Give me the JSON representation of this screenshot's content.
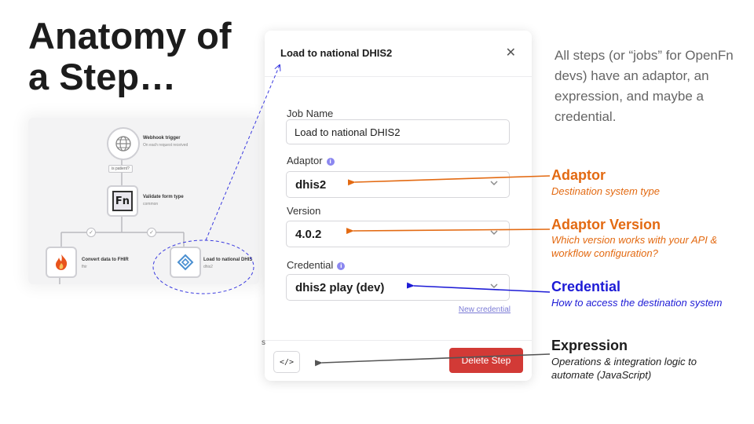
{
  "slide": {
    "title_line1": "Anatomy of",
    "title_line2": "a Step…",
    "intro": "All steps (or “jobs” for OpenFn devs) have an adaptor, an expression, and maybe a credential."
  },
  "workflow": {
    "trigger": {
      "label": "Webhook trigger",
      "sub": "On each request received",
      "icon": "globe-icon"
    },
    "edge_label": "is patient?",
    "validate": {
      "label": "Validate form type",
      "sub": "common",
      "icon_text": "Fn"
    },
    "convert": {
      "label": "Convert data to FHIR",
      "sub": "fhir",
      "icon": "flame-icon"
    },
    "load": {
      "label": "Load to national DHIS",
      "sub": "dhis2",
      "icon": "layers-icon"
    }
  },
  "modal": {
    "title": "Load to national DHIS2",
    "close_icon": "close-icon",
    "job_name_label": "Job Name",
    "job_name_value": "Load to national DHIS2",
    "adaptor_label": "Adaptor",
    "adaptor_value": "dhis2",
    "version_label": "Version",
    "version_value": "4.0.2",
    "credential_label": "Credential",
    "credential_value": "dhis2 play (dev)",
    "new_credential": "New credential",
    "code_button": "</>",
    "delete_button": "Delete Step",
    "stray_char": "s"
  },
  "annotations": {
    "adaptor": {
      "title": "Adaptor",
      "desc": "Destination system type"
    },
    "version": {
      "title": "Adaptor Version",
      "desc": "Which version works with your API & workflow configuration?"
    },
    "credential": {
      "title": "Credential",
      "desc": "How to access the destination system"
    },
    "expression": {
      "title": "Expression",
      "desc": "Operations & integration logic to automate (JavaScript)"
    }
  },
  "colors": {
    "orange": "#e36a12",
    "blue": "#1d1bd6",
    "delete": "#d23a36",
    "dark_arrow": "#555555"
  }
}
